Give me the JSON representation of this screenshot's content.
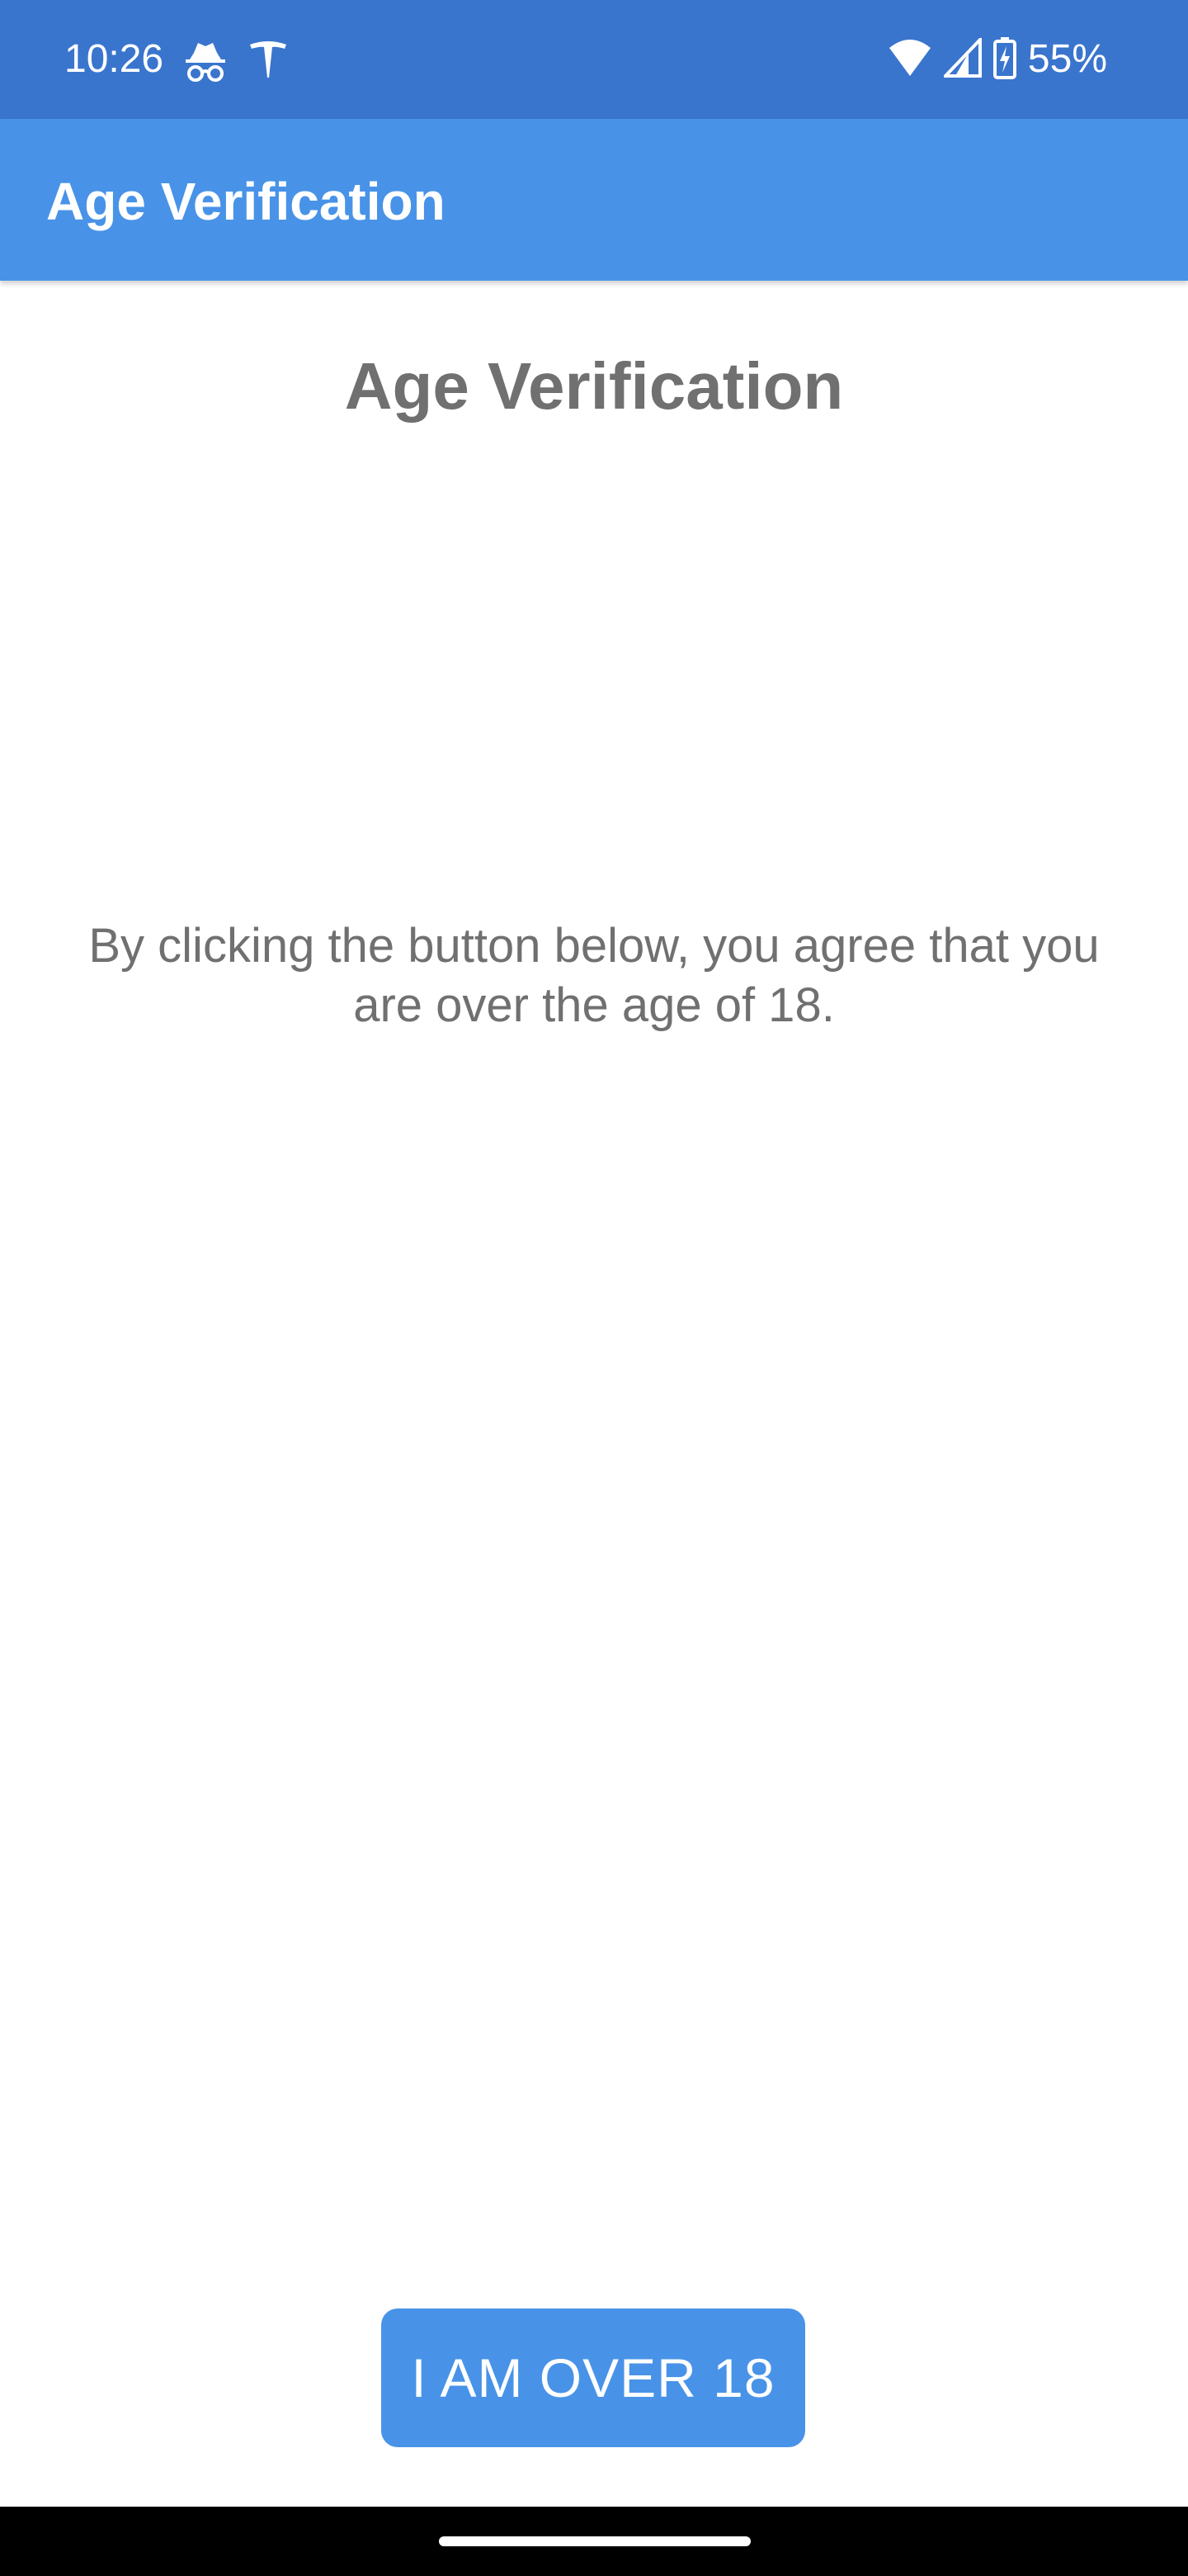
{
  "status_bar": {
    "time": "10:26",
    "battery": "55%",
    "icons": [
      "incognito-icon",
      "tesla-icon",
      "wifi-icon",
      "signal-icon",
      "battery-charging-icon"
    ]
  },
  "app_bar": {
    "title": "Age Verification"
  },
  "main": {
    "heading": "Age Verification",
    "message": "By clicking the button below, you agree that you are over the age of 18.",
    "button_label": "I AM OVER 18"
  },
  "colors": {
    "status_bar": "#3a75cd",
    "app_bar": "#4893e8",
    "button": "#4893e8",
    "text_gray": "#707070"
  }
}
